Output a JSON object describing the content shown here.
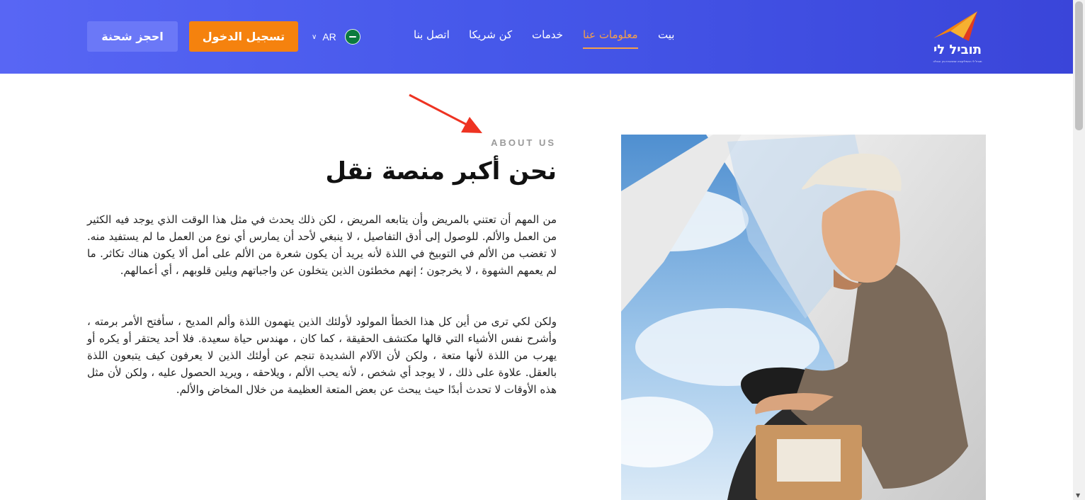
{
  "header": {
    "book_button": "احجز شحنة",
    "login_button": "تسجيل الدخول",
    "language": {
      "code": "AR",
      "flag_icon": "saudi-flag-icon",
      "chevron_icon": "chevron-down-icon"
    },
    "nav": [
      {
        "label": "بيت",
        "active": false
      },
      {
        "label": "معلومات عنا",
        "active": true
      },
      {
        "label": "خدمات",
        "active": false
      },
      {
        "label": "كن شريكا",
        "active": false
      },
      {
        "label": "اتصل بنا",
        "active": false
      }
    ],
    "logo": {
      "brand": "תוביל לי",
      "tagline": "תוביל לי האפליקציה שמחברת בין הובלה"
    }
  },
  "about": {
    "eyebrow": "ABOUT US",
    "title": "نحن أكبر منصة نقل",
    "paragraph1": "من المهم أن تعتني بالمريض وأن يتابعه المريض ، لكن ذلك يحدث في مثل هذا الوقت الذي يوجد فيه الكثير من العمل والألم. للوصول إلى أدق التفاصيل ، لا ينبغي لأحد أن يمارس أي نوع من العمل ما لم يستفيد منه. لا تغضب من الألم في التوبيخ في اللذة لأنه يريد أن يكون شعرة من الألم على أمل ألا يكون هناك تكاثر. ما لم يعمهم الشهوة ، لا يخرجون ؛ إنهم مخطئون الذين يتخلون عن واجباتهم ويلين قلوبهم ، أي أعمالهم.",
    "paragraph2": "ولكن لكي ترى من أين كل هذا الخطأ المولود لأولئك الذين يتهمون اللذة وألم المديح ، سأفتح الأمر برمته ، وأشرح نفس الأشياء التي قالها مكتشف الحقيقة ، كما كان ، مهندس حياة سعيدة. فلا أحد يحتقر أو يكره أو يهرب من اللذة لأنها متعة ، ولكن لأن الآلام الشديدة تنجم عن أولئك الذين لا يعرفون كيف يتبعون اللذة بالعقل. علاوة على ذلك ، لا يوجد أي شخص ، لأنه يحب الألم ، ويلاحقه ، ويريد الحصول عليه ، ولكن لأن مثل هذه الأوقات لا تحدث أبدًا حيث يبحث عن بعض المتعة العظيمة من خلال المخاض والألم.",
    "image": "delivery-driver-photo"
  },
  "colors": {
    "accent": "#f5820e",
    "header_start": "#5866f4",
    "header_end": "#3a45d9",
    "active_nav": "#f5a04a",
    "annotation_arrow": "#ee3322"
  }
}
